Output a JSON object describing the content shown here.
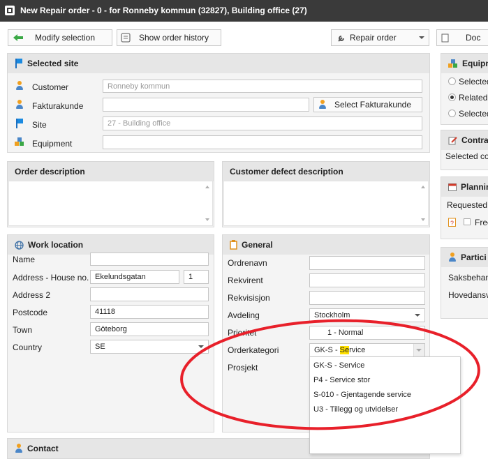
{
  "window": {
    "title": "New Repair order - 0 - for Ronneby kommun (32827), Building office (27)"
  },
  "toolbar": {
    "modify_selection": "Modify selection",
    "show_order_history": "Show order history",
    "repair_order": "Repair order",
    "doc_partial": "Doc"
  },
  "selected_site": {
    "title": "Selected site",
    "customer_label": "Customer",
    "customer_value": "Ronneby kommun",
    "fakturakunde_label": "Fakturakunde",
    "fakturakunde_value": "",
    "select_fakturakunde": "Select Fakturakunde",
    "site_label": "Site",
    "site_value": "27 - Building office",
    "equipment_label": "Equipment",
    "equipment_value": ""
  },
  "order_description": {
    "title": "Order description"
  },
  "customer_defect": {
    "title": "Customer defect description"
  },
  "work_location": {
    "title": "Work location",
    "name_label": "Name",
    "name_value": "",
    "address_label": "Address - House no.",
    "address_value": "Ekelundsgatan",
    "house_no": "1",
    "address2_label": "Address 2",
    "address2_value": "",
    "postcode_label": "Postcode",
    "postcode_value": "41118",
    "town_label": "Town",
    "town_value": "Göteborg",
    "country_label": "Country",
    "country_value": "SE"
  },
  "general": {
    "title": "General",
    "ordrenavn_label": "Ordrenavn",
    "rekvirent_label": "Rekvirent",
    "rekvisisjon_label": "Rekvisisjon",
    "avdeling_label": "Avdeling",
    "avdeling_value": "Stockholm",
    "prioritet_label": "Prioritet",
    "prioritet_value": "1 - Normal",
    "orderkategori_label": "Orderkategori",
    "orderkategori_prefix": "GK-S - ",
    "orderkategori_highlight": "Se",
    "orderkategori_suffix": "rvice",
    "prosjekt_label": "Prosjekt",
    "dropdown_options": [
      "GK-S - Service",
      "P4 - Service stor",
      "S-010 - Gjentagende service",
      "U3 - Tillegg og utvidelser"
    ]
  },
  "contact": {
    "title": "Contact"
  },
  "right_panel": {
    "equipment_title": "Equipm",
    "radio_selected": "Selected",
    "radio_related": "Related e",
    "radio_selected2": "Selected",
    "contract_title": "Contra",
    "contract_text": "Selected con",
    "planning_title": "Plannin",
    "planning_requested": "Requested d",
    "planning_free": "Free",
    "participants_title": "Partici",
    "saksbehandler": "Saksbehand",
    "hovedansvar": "Hovedansva"
  },
  "colors": {
    "highlight": "#ffe000",
    "annotation_ellipse": "#e8202a",
    "titlebar": "#3a3a3a"
  }
}
